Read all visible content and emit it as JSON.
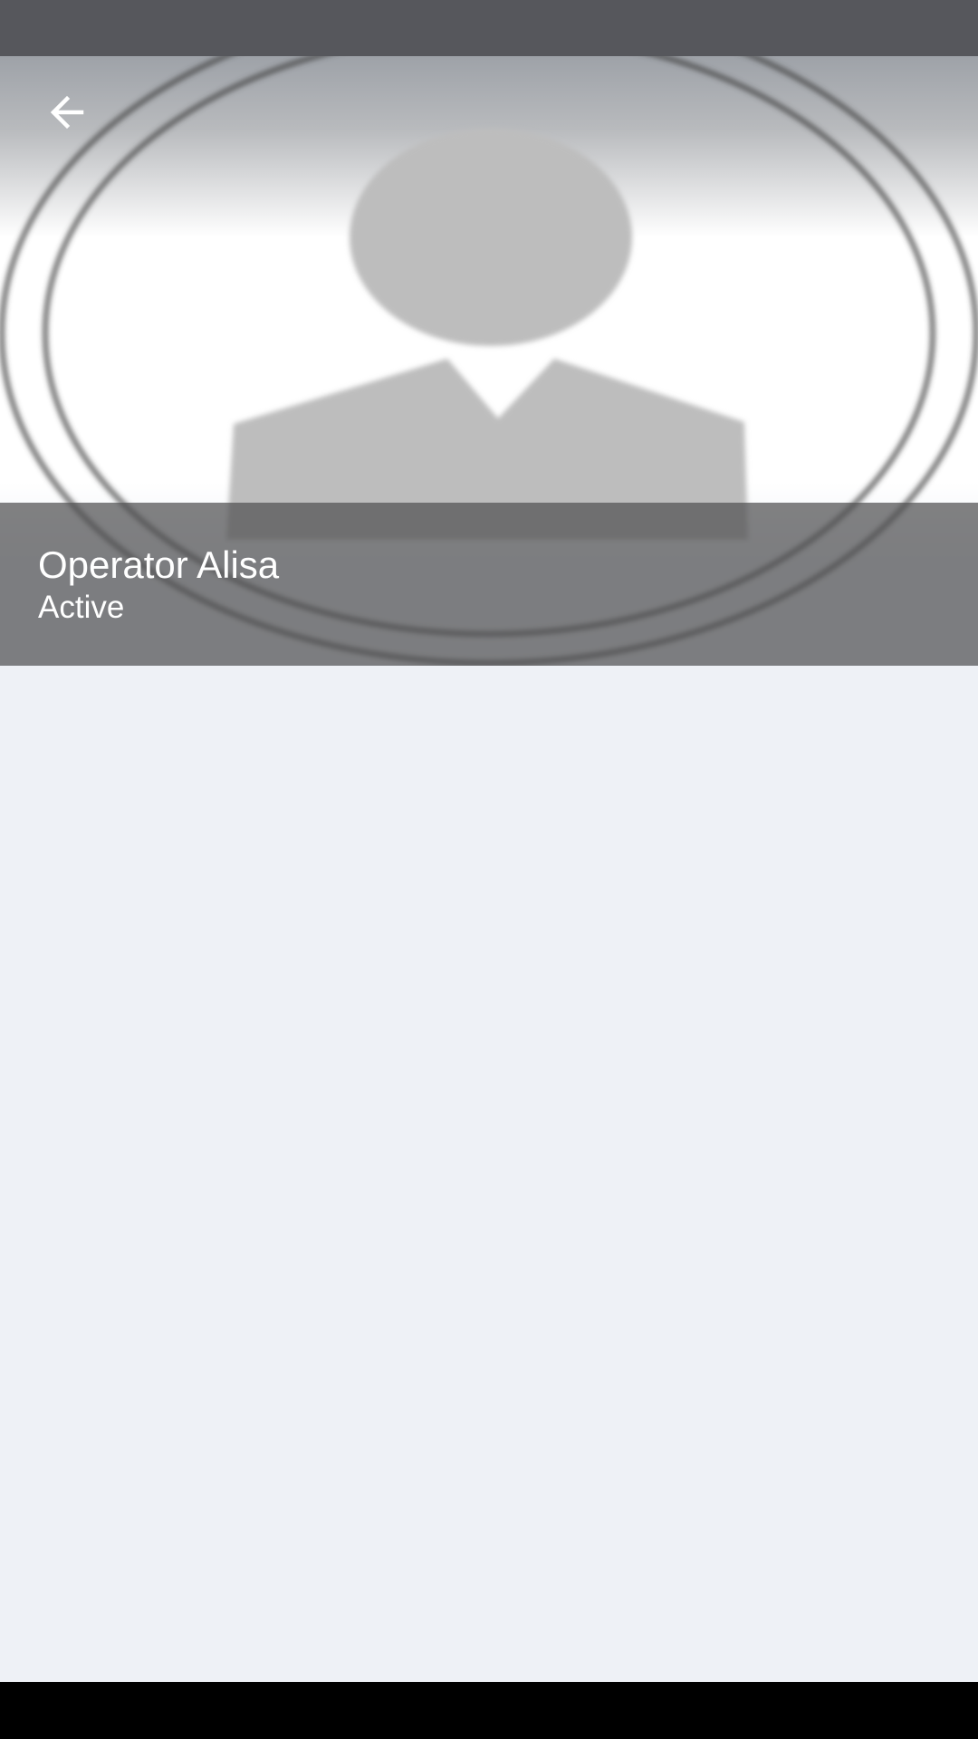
{
  "contact": {
    "name": "Operator Alisa",
    "status": "Active"
  },
  "icons": {
    "back": "arrow-left-icon",
    "avatar": "person-silhouette-icon"
  },
  "colors": {
    "status_bar": "#56575c",
    "name_panel": "#5a5a5c",
    "background": "#eef1f6",
    "avatar_fill": "#bdbdbd",
    "nav_bar": "#000000"
  }
}
